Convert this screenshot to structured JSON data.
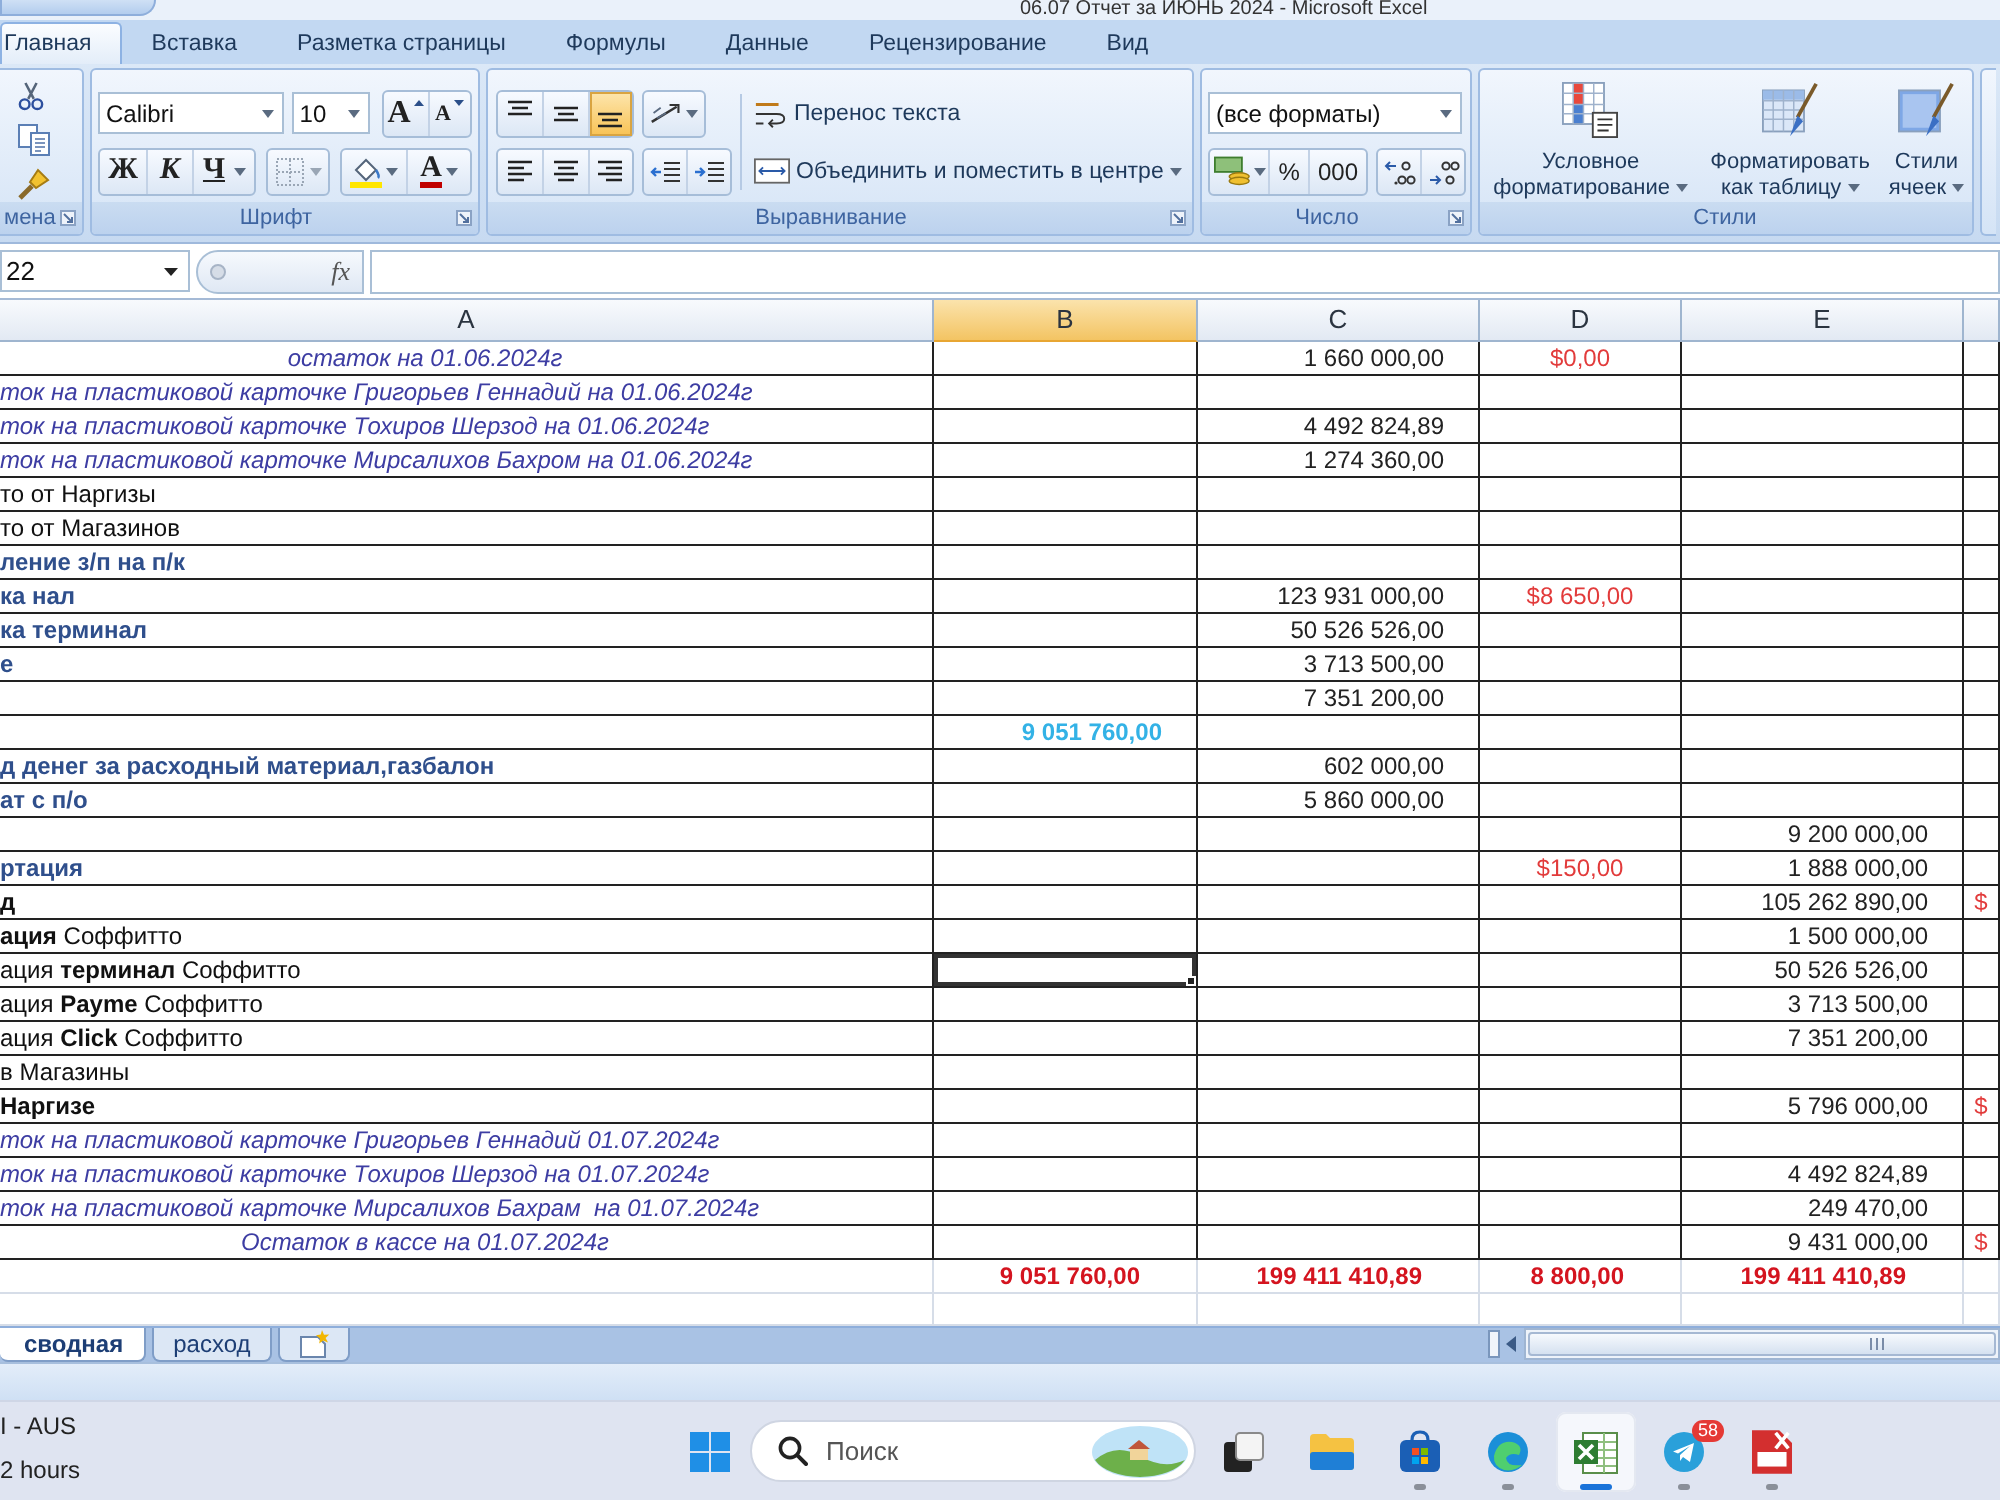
{
  "window": {
    "title": "06.07 Отчет за ИЮНЬ 2024 - Microsoft Excel"
  },
  "ribbon_tabs": [
    {
      "label": "Главная",
      "selected": true
    },
    {
      "label": "Вставка",
      "selected": false
    },
    {
      "label": "Разметка страницы",
      "selected": false
    },
    {
      "label": "Формулы",
      "selected": false
    },
    {
      "label": "Данные",
      "selected": false
    },
    {
      "label": "Рецензирование",
      "selected": false
    },
    {
      "label": "Вид",
      "selected": false
    }
  ],
  "ribbon": {
    "groups": [
      {
        "kind": "clipboard",
        "label": "мена"
      },
      {
        "kind": "font",
        "label": "Шрифт",
        "font_name": "Calibri",
        "font_size": "10",
        "grow_label": "A",
        "shrink_label": "A",
        "style_buttons": [
          {
            "kind": "bold",
            "label": "Ж"
          },
          {
            "kind": "italic",
            "label": "К"
          },
          {
            "kind": "underline",
            "label": "Ч"
          }
        ],
        "font_color_label": "A"
      },
      {
        "kind": "alignment",
        "label": "Выравнивание",
        "vertical": [
          {
            "kind": "top",
            "selected": false
          },
          {
            "kind": "middle",
            "selected": false
          },
          {
            "kind": "bottom",
            "selected": true
          }
        ],
        "horizontal": [
          {
            "kind": "left",
            "selected": false
          },
          {
            "kind": "center",
            "selected": false
          },
          {
            "kind": "right",
            "selected": false
          }
        ],
        "wrap_text": "Перенос текста",
        "merge": "Объединить и поместить в центре"
      },
      {
        "kind": "number",
        "label": "Число",
        "format": "(все форматы)",
        "percent_label": "%",
        "thousands_label": "000"
      },
      {
        "kind": "styles",
        "label": "Стили",
        "buttons": [
          {
            "kind": "conditional",
            "label": "Условное форматирование"
          },
          {
            "kind": "table",
            "label": "Форматировать как таблицу"
          },
          {
            "kind": "cell",
            "label": "Стили ячеек"
          }
        ]
      },
      {
        "kind": "partial"
      }
    ]
  },
  "formula_bar": {
    "name_box": "22",
    "function_label": "fx"
  },
  "sheet": {
    "columns": [
      {
        "label": "A",
        "selected": false
      },
      {
        "label": "B",
        "selected": true
      },
      {
        "label": "C",
        "selected": false
      },
      {
        "label": "D",
        "selected": false
      },
      {
        "label": "E",
        "selected": false
      },
      {
        "selected": false
      }
    ],
    "rows": [
      {
        "cells": [
          {
            "text": "остаток на 01.06.2024г",
            "kind": "caption"
          },
          null,
          {
            "text": "1 660 000,00",
            "kind": "amount"
          },
          {
            "text": "$0,00",
            "kind": "currency"
          }
        ]
      },
      {
        "cells": [
          {
            "text": "ток на пластиковой карточке Григорьев Геннадий на 01.06.2024г",
            "kind": "note"
          }
        ]
      },
      {
        "cells": [
          {
            "text": "ток на пластиковой карточке Тохиров Шерзод на 01.06.2024г",
            "kind": "note"
          },
          null,
          {
            "text": "4 492 824,89",
            "kind": "amount"
          }
        ]
      },
      {
        "cells": [
          {
            "text": "ток на пластиковой карточке Мирсалихов Бахром на 01.06.2024г",
            "kind": "note"
          },
          null,
          {
            "text": "1 274 360,00",
            "kind": "amount"
          }
        ]
      },
      {
        "cells": [
          {
            "text": "то от Наргизы",
            "kind": "plain"
          }
        ]
      },
      {
        "cells": [
          {
            "text": "то от Магазинов",
            "kind": "plain"
          }
        ]
      },
      {
        "cells": [
          {
            "text": "ление з/п на п/к",
            "kind": "heading"
          }
        ]
      },
      {
        "cells": [
          {
            "text": "ка нал",
            "kind": "heading"
          },
          null,
          {
            "text": "123 931 000,00",
            "kind": "amount"
          },
          {
            "text": "$8 650,00",
            "kind": "currency"
          }
        ]
      },
      {
        "cells": [
          {
            "text": "ка терминал",
            "kind": "heading"
          },
          null,
          {
            "text": "50 526 526,00",
            "kind": "amount"
          }
        ]
      },
      {
        "cells": [
          {
            "text": "е",
            "kind": "heading"
          },
          null,
          {
            "text": "3 713 500,00",
            "kind": "amount"
          }
        ]
      },
      {
        "cells": [
          null,
          null,
          {
            "text": "7 351 200,00",
            "kind": "amount"
          }
        ]
      },
      {
        "cells": [
          null,
          {
            "text": "9 051 760,00",
            "kind": "highlight"
          }
        ]
      },
      {
        "cells": [
          {
            "text": "д денег за расходный материал,газбалон",
            "kind": "heading"
          },
          null,
          {
            "text": "602 000,00",
            "kind": "amount"
          }
        ]
      },
      {
        "cells": [
          {
            "text": "ат с п/о",
            "kind": "heading"
          },
          null,
          {
            "text": "5 860 000,00",
            "kind": "amount"
          }
        ]
      },
      {
        "cells": [
          null,
          null,
          null,
          null,
          {
            "text": "9 200 000,00",
            "kind": "amount"
          }
        ]
      },
      {
        "cells": [
          {
            "text": "ртация",
            "kind": "heading"
          },
          null,
          null,
          {
            "text": "$150,00",
            "kind": "currency"
          },
          {
            "text": "1 888 000,00",
            "kind": "amount"
          }
        ]
      },
      {
        "cells": [
          {
            "text": "д",
            "kind": "bold"
          },
          null,
          null,
          null,
          {
            "text": "105 262 890,00",
            "kind": "amount"
          },
          {
            "text": "$",
            "kind": "currency"
          }
        ]
      },
      {
        "cells": [
          {
            "text": "**ация** Соффитто",
            "kind": "plain"
          },
          null,
          null,
          null,
          {
            "text": "1 500 000,00",
            "kind": "amount"
          }
        ]
      },
      {
        "cells": [
          {
            "text": "ация **терминал** Соффитто",
            "kind": "plain"
          },
          {
            "selected": true
          },
          null,
          null,
          {
            "text": "50 526 526,00",
            "kind": "amount"
          }
        ]
      },
      {
        "cells": [
          {
            "text": "ация **Payme** Соффитто",
            "kind": "plain"
          },
          null,
          null,
          null,
          {
            "text": "3 713 500,00",
            "kind": "amount"
          }
        ]
      },
      {
        "cells": [
          {
            "text": "ация **Click** Соффитто",
            "kind": "plain"
          },
          null,
          null,
          null,
          {
            "text": "7 351 200,00",
            "kind": "amount"
          }
        ]
      },
      {
        "cells": [
          {
            "text": "в Магазины",
            "kind": "plain"
          }
        ]
      },
      {
        "cells": [
          {
            "text": "Наргизе",
            "kind": "bold"
          },
          null,
          null,
          null,
          {
            "text": "5 796 000,00",
            "kind": "amount"
          },
          {
            "text": "$",
            "kind": "currency"
          }
        ]
      },
      {
        "cells": [
          {
            "text": "ток на пластиковой карточке Григорьев Геннадий 01.07.2024г",
            "kind": "note"
          }
        ]
      },
      {
        "cells": [
          {
            "text": "ток на пластиковой карточке Тохиров Шерзод на 01.07.2024г",
            "kind": "note"
          },
          null,
          null,
          null,
          {
            "text": "4 492 824,89",
            "kind": "amount"
          }
        ]
      },
      {
        "cells": [
          {
            "text": "ток на пластиковой карточке Мирсалихов Бахрам  на 01.07.2024г",
            "kind": "note"
          },
          null,
          null,
          null,
          {
            "text": "249 470,00",
            "kind": "amount"
          }
        ]
      },
      {
        "cells": [
          {
            "text": "Остаток в кассе на 01.07.2024г",
            "kind": "caption"
          },
          null,
          null,
          null,
          {
            "text": "9 431 000,00",
            "kind": "amount"
          },
          {
            "text": "$",
            "kind": "currency"
          }
        ]
      }
    ],
    "total_row": {
      "cells": [
        null,
        {
          "text": "9 051 760,00",
          "kind": "total"
        },
        {
          "text": "199 411 410,89",
          "kind": "total"
        },
        {
          "text": "8 800,00",
          "kind": "total"
        },
        {
          "text": "199 411 410,89",
          "kind": "total"
        }
      ]
    }
  },
  "sheet_tabs": [
    {
      "label": "сводная",
      "selected": true
    },
    {
      "label": "расход",
      "selected": false
    }
  ],
  "taskbar": {
    "widget_lines": [
      "I - AUS",
      "2 hours"
    ],
    "search": {
      "placeholder": "Поиск"
    },
    "apps": [
      {
        "kind": "task_view",
        "running": false,
        "selected": false
      },
      {
        "kind": "explorer",
        "running": false,
        "selected": false
      },
      {
        "kind": "store",
        "running": true,
        "selected": false
      },
      {
        "kind": "edge",
        "running": true,
        "selected": false
      },
      {
        "kind": "excel",
        "running": true,
        "selected": true
      },
      {
        "kind": "telegram",
        "running": true,
        "selected": false,
        "badge": "58"
      },
      {
        "kind": "pdf",
        "running": true,
        "selected": false
      }
    ]
  }
}
